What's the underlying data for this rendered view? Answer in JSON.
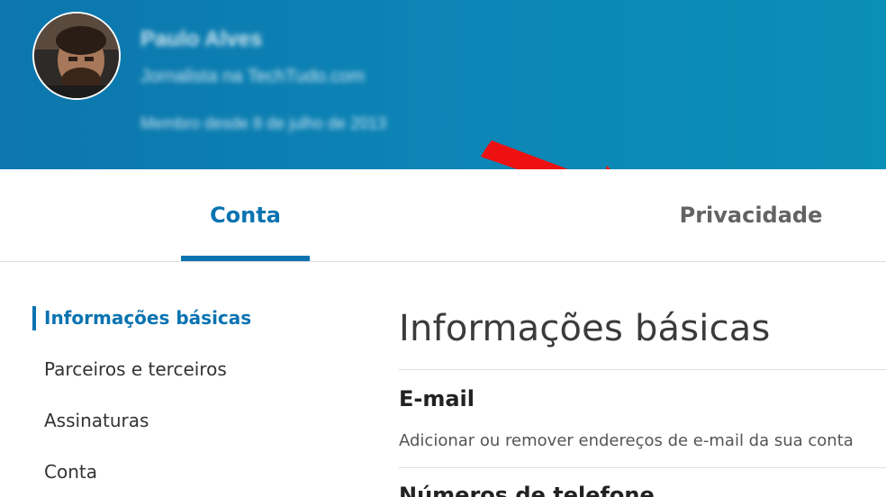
{
  "profile": {
    "name": "Paulo Alves",
    "title": "Jornalista na TechTudo.com",
    "member_since": "Membro desde 8 de julho de 2013"
  },
  "tabs": [
    {
      "label": "Conta",
      "active": true
    },
    {
      "label": "Privacidade",
      "active": false
    }
  ],
  "sidebar": {
    "items": [
      {
        "label": "Informações básicas",
        "active": true
      },
      {
        "label": "Parceiros e terceiros",
        "active": false
      },
      {
        "label": "Assinaturas",
        "active": false
      },
      {
        "label": "Conta",
        "active": false
      }
    ]
  },
  "main": {
    "section_title": "Informações básicas",
    "items": [
      {
        "title": "E-mail",
        "description": "Adicionar ou remover endereços de e-mail da sua conta"
      },
      {
        "title": "Números de telefone",
        "description": ""
      }
    ]
  },
  "colors": {
    "header_bg": "#0c86b6",
    "accent": "#0a73b1",
    "annotation_arrow": "#ee1111"
  }
}
